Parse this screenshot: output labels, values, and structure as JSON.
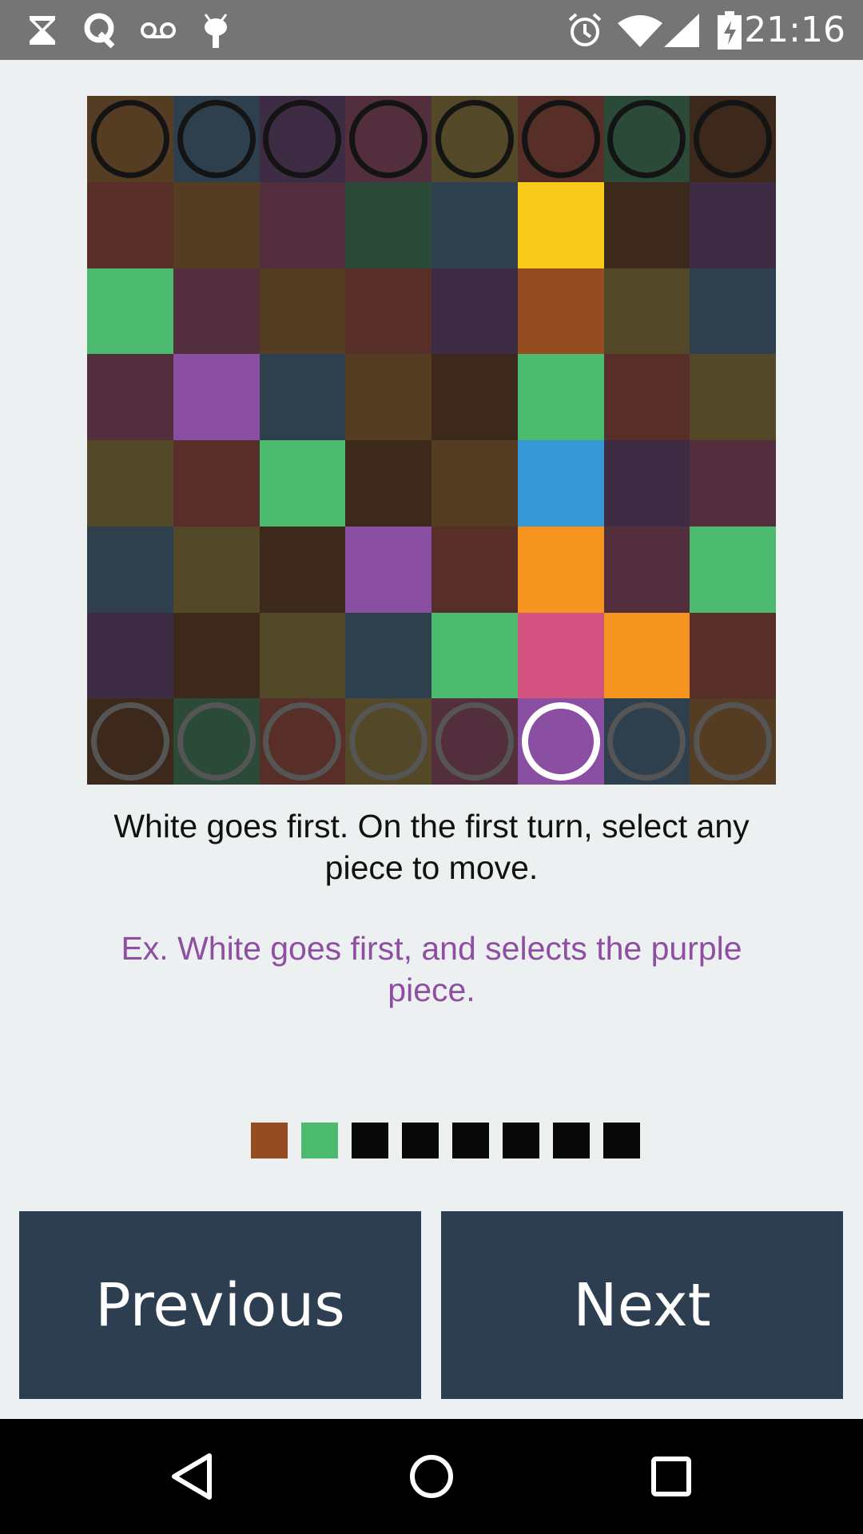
{
  "status_bar": {
    "time": "21:16",
    "left_icons": [
      "hourglass-icon",
      "quora-icon",
      "voicemail-icon",
      "android-debug-icon"
    ],
    "right_icons": [
      "alarm-icon",
      "wifi-icon",
      "signal-icon",
      "battery-charging-icon"
    ]
  },
  "board": {
    "cells": [
      [
        "#553d24",
        "#2e404d",
        "#3e2b44",
        "#532e3c",
        "#534928",
        "#582e29",
        "#2b4a38",
        "#3d291c"
      ],
      [
        "#582e29",
        "#553d24",
        "#532e3c",
        "#2b4a38",
        "#2e404d",
        "#f8ca19",
        "#3d291c",
        "#3e2b44"
      ],
      [
        "#4cbb6f",
        "#532e3c",
        "#553d24",
        "#582e29",
        "#3e2b44",
        "#954c20",
        "#534928",
        "#2e404d"
      ],
      [
        "#532e3c",
        "#8a4ea2",
        "#2e404d",
        "#553d24",
        "#3d291c",
        "#4cbb6f",
        "#582e29",
        "#534928"
      ],
      [
        "#534928",
        "#582e29",
        "#4cbb6f",
        "#3d291c",
        "#553d24",
        "#3798d7",
        "#3e2b44",
        "#532e3c"
      ],
      [
        "#2e404d",
        "#534928",
        "#3d291c",
        "#8a4ea2",
        "#582e29",
        "#f69420",
        "#532e3c",
        "#4cbb6f"
      ],
      [
        "#3e2b44",
        "#3d291c",
        "#534928",
        "#2e404d",
        "#4cbb6f",
        "#d3527f",
        "#f69420",
        "#582e29"
      ],
      [
        "#3d291c",
        "#2b4a38",
        "#582e29",
        "#534928",
        "#532e3c",
        "#8a4ea2",
        "#2e404d",
        "#553d24"
      ]
    ],
    "black_pieces_row": 0,
    "white_pieces_row": 7,
    "selected_piece": {
      "row": 7,
      "col": 5
    }
  },
  "instruction_text": "White goes first. On the first turn, select any piece to move.",
  "example_text": "Ex. White goes first, and selects the purple piece.",
  "progress_dots": [
    "#954c20",
    "#4cbb6f",
    "#080808",
    "#080808",
    "#080808",
    "#080808",
    "#080808",
    "#080808"
  ],
  "buttons": {
    "previous_label": "Previous",
    "next_label": "Next"
  },
  "nav_bar": {
    "icons": [
      "back-icon",
      "home-icon",
      "recents-icon"
    ]
  }
}
